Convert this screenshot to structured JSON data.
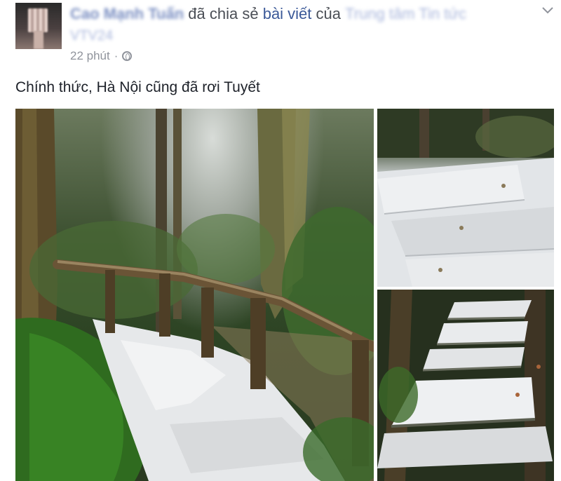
{
  "post": {
    "author_name": "Cao Mạnh Tuấn",
    "shared_verb": "đã chia sẻ",
    "link_text": "bài viết",
    "of_text": "của",
    "page_name": "Trung tâm Tin tức",
    "page_name_line2": "VTV24",
    "time": "22 phút",
    "separator": "·",
    "privacy_icon": "globe-icon",
    "menu_icon": "chevron-down-icon",
    "body": "Chính thức, Hà Nội cũng đã rơi Tuyết"
  },
  "photos": [
    {
      "name": "forest-path-snow",
      "alt": "snowy forest trail with wooden railing"
    },
    {
      "name": "snowy-stairs-top",
      "alt": "snow covered stone steps"
    },
    {
      "name": "snowy-stairs-bottom",
      "alt": "snow covered stone stairway"
    }
  ],
  "colors": {
    "link": "#3b5998",
    "meta": "#90949c",
    "text": "#1d2129"
  }
}
